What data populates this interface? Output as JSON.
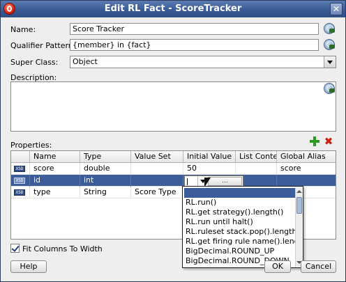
{
  "window": {
    "title": "Edit RL Fact - ScoreTracker"
  },
  "form": {
    "name_label": "Name:",
    "name_value": "Score Tracker",
    "qualifier_label": "Qualifier Pattern:",
    "qualifier_value": "{member} in {fact}",
    "superclass_label": "Super Class:",
    "superclass_value": "Object",
    "description_label": "Description:",
    "description_value": ""
  },
  "properties": {
    "label": "Properties:",
    "columns": [
      "Name",
      "Type",
      "Value Set",
      "Initial Value",
      "List Content",
      "Global Alias"
    ],
    "rows": [
      {
        "icon": "xsd-icon",
        "name": "score",
        "type": "double",
        "value_set": "",
        "initial_value": "50",
        "list_content": "",
        "global_alias": "score"
      },
      {
        "icon": "xsd-icon",
        "name": "id",
        "type": "int",
        "value_set": "",
        "initial_value": "",
        "list_content": "",
        "global_alias": ""
      },
      {
        "icon": "xsd-icon",
        "name": "type",
        "type": "String",
        "value_set": "Score Type",
        "initial_value": "",
        "list_content": "",
        "global_alias": ""
      }
    ],
    "icon_text": "XSD",
    "editor_button": "..."
  },
  "dropdown": {
    "items": [
      "",
      "RL.run()",
      "RL.get strategy().length()",
      "RL.run until halt()",
      "RL.ruleset stack.pop().length()",
      "RL.get firing rule name().length()",
      "BigDecimal.ROUND_UP",
      "BigDecimal.ROUND_DOWN"
    ],
    "selected_index": 0
  },
  "footer": {
    "fit_columns_label": "Fit Columns To Width",
    "fit_columns_checked": true,
    "help_label": "Help",
    "ok_label": "OK",
    "cancel_label": "Cancel"
  },
  "colors": {
    "title_bar": "#3a5b95",
    "selection": "#3c5d9a",
    "add": "#2c9a20",
    "delete": "#d01c0a"
  }
}
